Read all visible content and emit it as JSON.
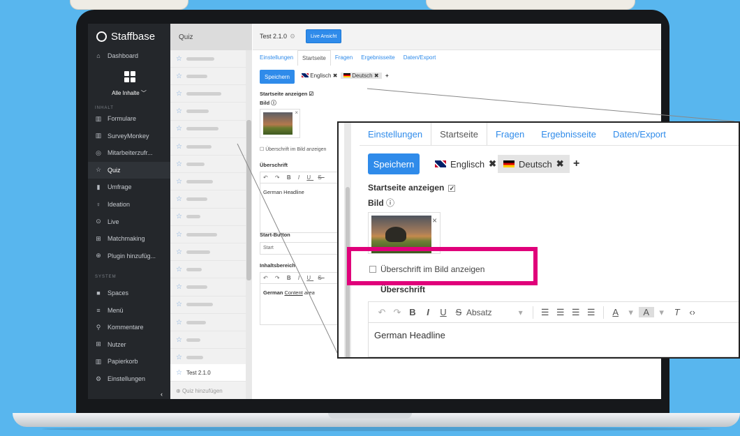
{
  "sidebar": {
    "logo": "Staffbase",
    "dashboard": "Dashboard",
    "all_content": "Alle Inhalte",
    "section_content": "INHALT",
    "section_system": "SYSTEM",
    "content_items": [
      {
        "icon": "form-icon",
        "glyph": "▥",
        "label": "Formulare"
      },
      {
        "icon": "survey-icon",
        "glyph": "▥",
        "label": "SurveyMonkey"
      },
      {
        "icon": "circle-icon",
        "glyph": "◎",
        "label": "Mitarbeiterzufr..."
      },
      {
        "icon": "star-icon",
        "glyph": "☆",
        "label": "Quiz"
      },
      {
        "icon": "chart-icon",
        "glyph": "▮",
        "label": "Umfrage"
      },
      {
        "icon": "lightbulb-icon",
        "glyph": "♀",
        "label": "Ideation"
      },
      {
        "icon": "live-icon",
        "glyph": "⊙",
        "label": "Live"
      },
      {
        "icon": "match-icon",
        "glyph": "⊞",
        "label": "Matchmaking"
      },
      {
        "icon": "plugin-icon",
        "glyph": "⊕",
        "label": "Plugin hinzufüg..."
      }
    ],
    "system_items": [
      {
        "icon": "spaces-icon",
        "glyph": "■",
        "label": "Spaces"
      },
      {
        "icon": "menu-icon",
        "glyph": "≡",
        "label": "Menü"
      },
      {
        "icon": "comment-icon",
        "glyph": "⚲",
        "label": "Kommentare"
      },
      {
        "icon": "users-icon",
        "glyph": "⊞",
        "label": "Nutzer"
      },
      {
        "icon": "trash-icon",
        "glyph": "▥",
        "label": "Papierkorb"
      },
      {
        "icon": "gear-icon",
        "glyph": "⚙",
        "label": "Einstellungen"
      }
    ]
  },
  "quiz": {
    "header": "Quiz",
    "selected": "Test 2.1.0",
    "add": "Quiz hinzufügen"
  },
  "main": {
    "title": "Test 2.1.0",
    "live_button": "Live Ansicht",
    "tabs": [
      "Einstellungen",
      "Startseite",
      "Fragen",
      "Ergebnisseite",
      "Daten/Export"
    ],
    "save": "Speichern",
    "lang_en": "Englisch",
    "lang_de": "Deutsch",
    "show_start": "Startseite anzeigen",
    "image_label": "Bild",
    "headline_in_image": "Überschrift im Bild anzeigen",
    "headline_label": "Überschrift",
    "headline_value": "German Headline",
    "start_button_label": "Start-Button",
    "start_button_value": "Start",
    "content_label": "Inhaltsbereich",
    "content_bold": "German",
    "content_link": "Content",
    "content_italic": "area",
    "format_select": "Absatz"
  },
  "colors": {
    "accent": "#2f8bea",
    "highlight": "#e0007a",
    "sidebar": "#24272b",
    "background": "#58b6ee"
  }
}
